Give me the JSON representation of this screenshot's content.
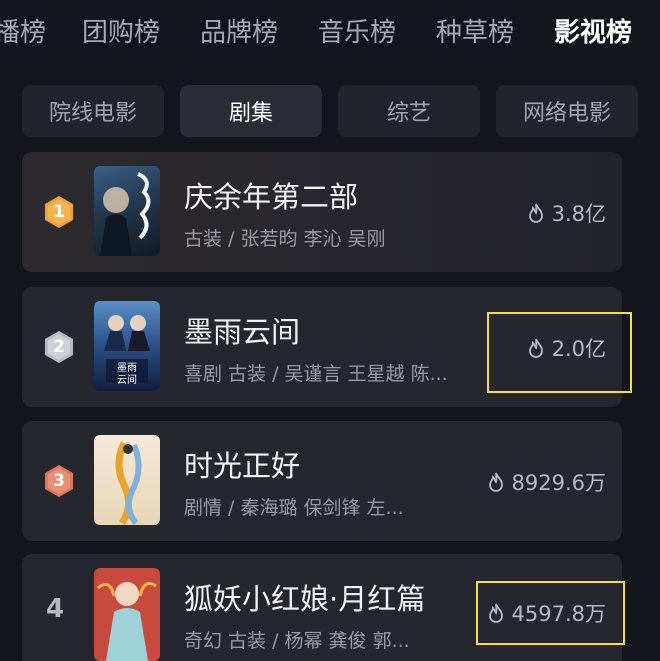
{
  "top_tabs": [
    {
      "label": "播榜"
    },
    {
      "label": "团购榜"
    },
    {
      "label": "品牌榜"
    },
    {
      "label": "音乐榜"
    },
    {
      "label": "种草榜"
    },
    {
      "label": "影视榜",
      "active": true
    }
  ],
  "category_tabs": [
    {
      "label": "院线电影"
    },
    {
      "label": "剧集",
      "active": true
    },
    {
      "label": "综艺"
    },
    {
      "label": "网络电影"
    }
  ],
  "ranking": [
    {
      "rank": "1",
      "title": "庆余年第二部",
      "tags": "古装 / 张若昀 李沁 吴刚",
      "heat": "3.8亿",
      "badge_color": "#f0a23a"
    },
    {
      "rank": "2",
      "title": "墨雨云间",
      "tags": "喜剧 古装 / 吴谨言 王星越 陈...",
      "heat": "2.0亿",
      "badge_color": "#c9c9d4"
    },
    {
      "rank": "3",
      "title": "时光正好",
      "tags": "剧情 / 秦海璐 保剑锋 左...",
      "heat": "8929.6万",
      "badge_color": "#e58a70"
    },
    {
      "rank": "4",
      "title": "狐妖小红娘·月红篇",
      "tags": "奇幻 古装 / 杨幂 龚俊 郭...",
      "heat": "4597.8万"
    }
  ]
}
